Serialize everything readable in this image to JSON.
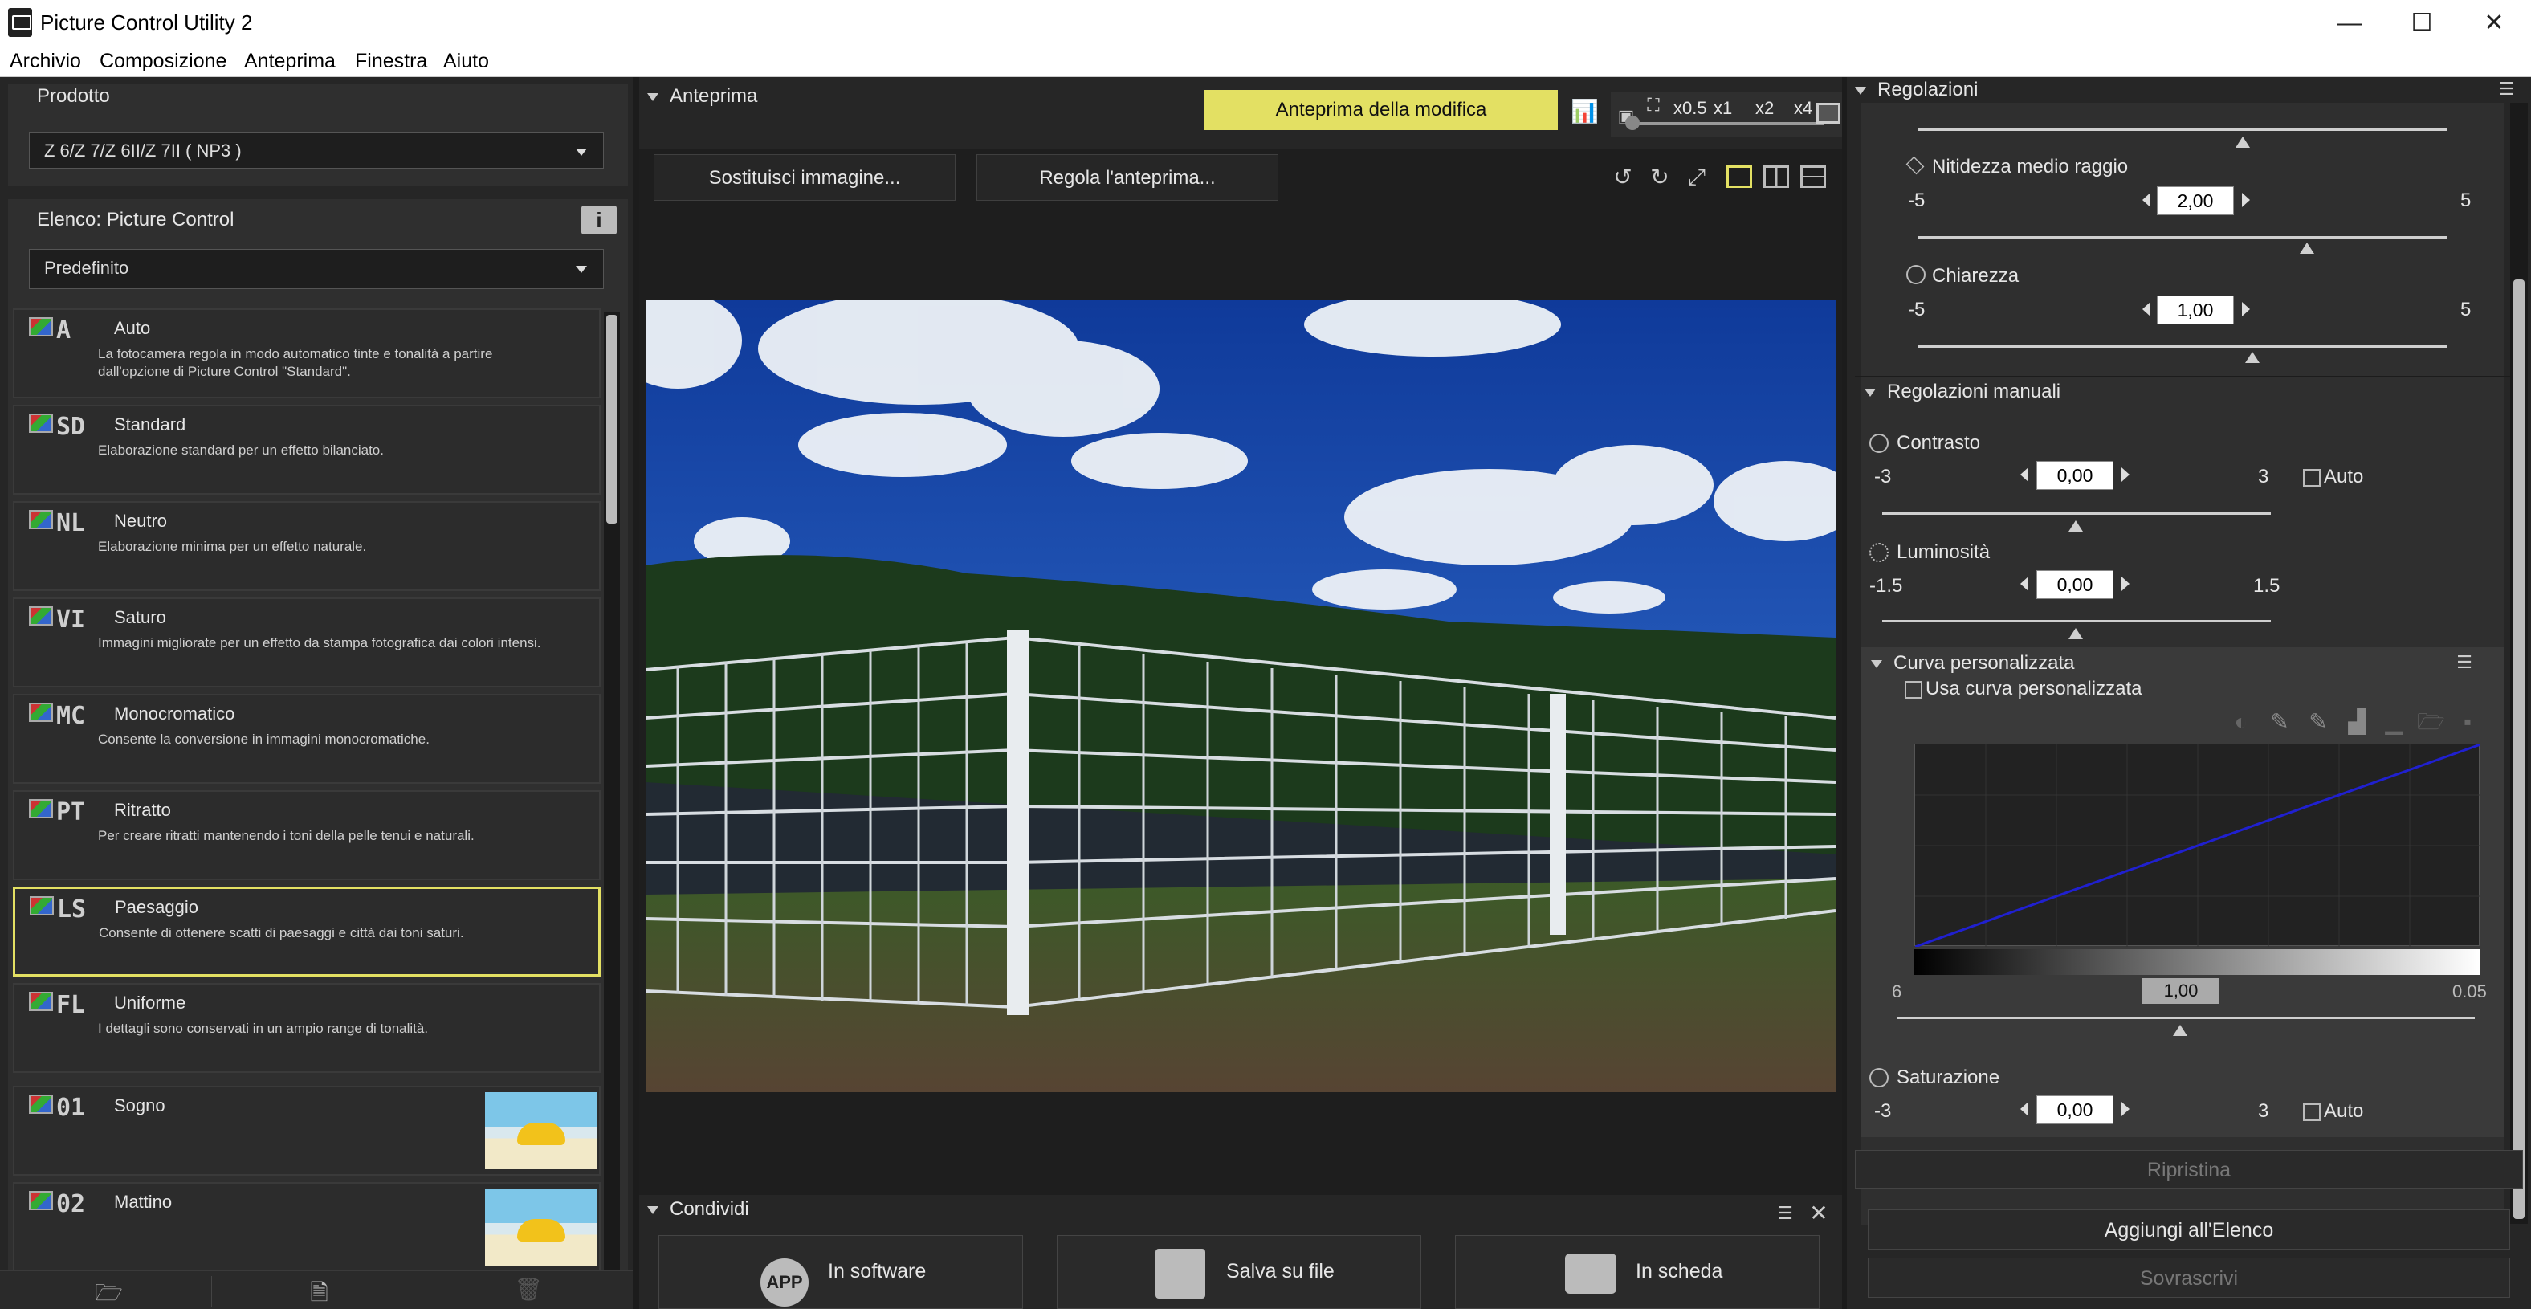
{
  "window": {
    "title": "Picture Control Utility 2",
    "minimize": "—",
    "maximize": "☐",
    "close": "✕"
  },
  "menu": [
    "Archivio",
    "Composizione",
    "Anteprima",
    "Finestra",
    "Aiuto"
  ],
  "left": {
    "product_header": "Prodotto",
    "product_value": "Z 6/Z 7/Z 6II/Z 7II ( NP3 )",
    "list_header": "Elenco: Picture Control",
    "list_filter": "Predefinito",
    "items": [
      {
        "code": "A",
        "name": "Auto",
        "desc": "La fotocamera regola in modo automatico tinte e tonalità a partire dall'opzione di Picture Control \"Standard\"."
      },
      {
        "code": "SD",
        "name": "Standard",
        "desc": "Elaborazione standard per un effetto bilanciato."
      },
      {
        "code": "NL",
        "name": "Neutro",
        "desc": "Elaborazione minima per un effetto naturale."
      },
      {
        "code": "VI",
        "name": "Saturo",
        "desc": "Immagini migliorate per un effetto da stampa fotografica dai colori intensi."
      },
      {
        "code": "MC",
        "name": "Monocromatico",
        "desc": "Consente la conversione in immagini monocromatiche."
      },
      {
        "code": "PT",
        "name": "Ritratto",
        "desc": "Per creare ritratti mantenendo i toni della pelle tenui e naturali."
      },
      {
        "code": "LS",
        "name": "Paesaggio",
        "desc": "Consente di ottenere scatti di paesaggi e città dai toni saturi."
      },
      {
        "code": "FL",
        "name": "Uniforme",
        "desc": "I dettagli sono conservati in un ampio range di tonalità."
      },
      {
        "code": "01",
        "name": "Sogno",
        "desc": ""
      },
      {
        "code": "02",
        "name": "Mattino",
        "desc": ""
      }
    ],
    "selected_index": 6
  },
  "preview": {
    "header": "Anteprima",
    "edit_preview_btn": "Anteprima della modifica",
    "zoom": [
      "x0.5",
      "x1",
      "x2",
      "x4"
    ],
    "replace_image_btn": "Sostituisci immagine...",
    "adjust_preview_btn": "Regola l'anteprima..."
  },
  "share": {
    "header": "Condividi",
    "buttons": [
      {
        "label": "In software",
        "icon": "app-icon"
      },
      {
        "label": "Salva su file",
        "icon": "floppy-disk-icon"
      },
      {
        "label": "In scheda",
        "icon": "camera-icon"
      }
    ]
  },
  "adjustments": {
    "header": "Regolazioni",
    "mid_sharpening": {
      "label": "Nitidezza medio raggio",
      "min": "-5",
      "max": "5",
      "value": "2,00"
    },
    "clarity": {
      "label": "Chiarezza",
      "min": "-5",
      "max": "5",
      "value": "1,00"
    },
    "manual_header": "Regolazioni manuali",
    "contrast": {
      "label": "Contrasto",
      "min": "-3",
      "max": "3",
      "value": "0,00",
      "auto": "Auto"
    },
    "brightness": {
      "label": "Luminosità",
      "min": "-1.5",
      "max": "1.5",
      "value": "0,00"
    },
    "curve_header": "Curva personalizzata",
    "use_curve": "Usa curva personalizzata",
    "curve_min": "6",
    "curve_mid": "1,00",
    "curve_max": "0.05",
    "saturation": {
      "label": "Saturazione",
      "min": "-3",
      "max": "3",
      "value": "0,00",
      "auto": "Auto"
    },
    "reset_btn": "Ripristina",
    "add_btn": "Aggiungi all'Elenco",
    "overwrite_btn": "Sovrascrivi"
  },
  "colors": {
    "accent": "#e3e063",
    "curve_line": "#2020d0"
  }
}
